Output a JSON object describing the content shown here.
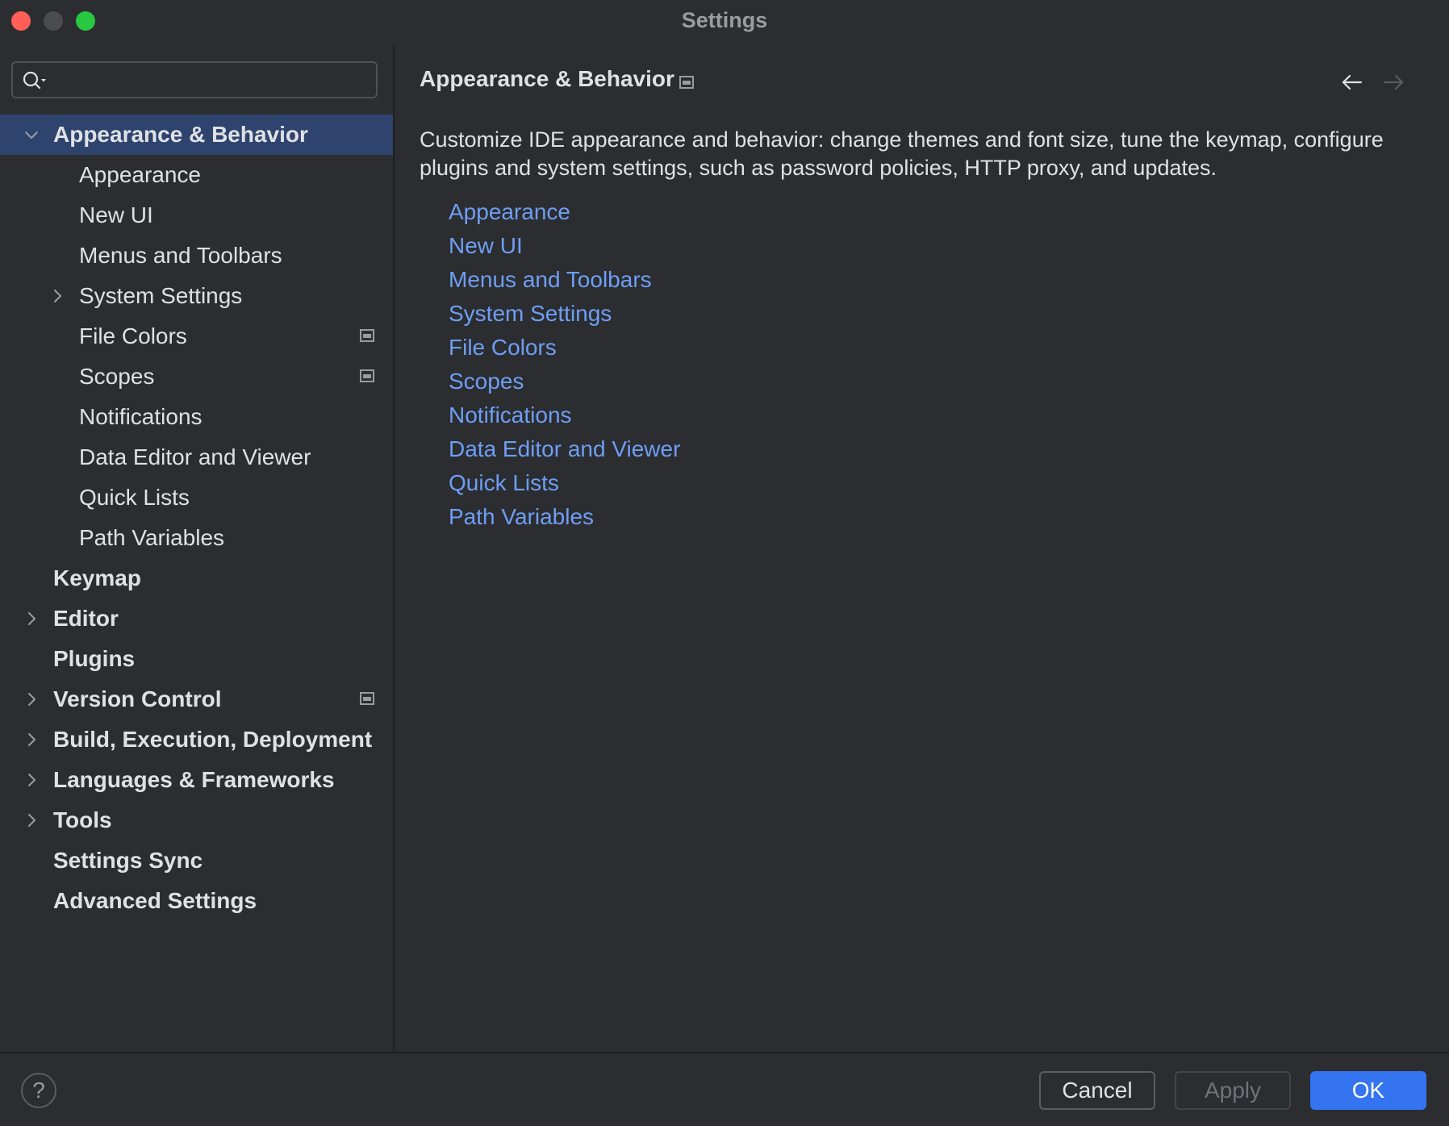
{
  "window": {
    "title": "Settings"
  },
  "search": {
    "value": ""
  },
  "tree": [
    {
      "label": "Appearance & Behavior",
      "level": 0,
      "expanded": true,
      "chevron": "down",
      "selected": true,
      "top": true
    },
    {
      "label": "Appearance",
      "level": 1
    },
    {
      "label": "New UI",
      "level": 1
    },
    {
      "label": "Menus and Toolbars",
      "level": 1
    },
    {
      "label": "System Settings",
      "level": 1,
      "chevron": "right"
    },
    {
      "label": "File Colors",
      "level": 1,
      "project_icon": true
    },
    {
      "label": "Scopes",
      "level": 1,
      "project_icon": true
    },
    {
      "label": "Notifications",
      "level": 1
    },
    {
      "label": "Data Editor and Viewer",
      "level": 1
    },
    {
      "label": "Quick Lists",
      "level": 1
    },
    {
      "label": "Path Variables",
      "level": 1
    },
    {
      "label": "Keymap",
      "level": 0,
      "top": true
    },
    {
      "label": "Editor",
      "level": 0,
      "chevron": "right",
      "top": true
    },
    {
      "label": "Plugins",
      "level": 0,
      "top": true
    },
    {
      "label": "Version Control",
      "level": 0,
      "chevron": "right",
      "top": true,
      "project_icon": true
    },
    {
      "label": "Build, Execution, Deployment",
      "level": 0,
      "chevron": "right",
      "top": true
    },
    {
      "label": "Languages & Frameworks",
      "level": 0,
      "chevron": "right",
      "top": true
    },
    {
      "label": "Tools",
      "level": 0,
      "chevron": "right",
      "top": true
    },
    {
      "label": "Settings Sync",
      "level": 0,
      "top": true
    },
    {
      "label": "Advanced Settings",
      "level": 0,
      "top": true
    }
  ],
  "main": {
    "title": "Appearance & Behavior",
    "description": "Customize IDE appearance and behavior: change themes and font size, tune the keymap, configure plugins and system settings, such as password policies, HTTP proxy, and updates.",
    "links": [
      "Appearance",
      "New UI",
      "Menus and Toolbars",
      "System Settings",
      "File Colors",
      "Scopes",
      "Notifications",
      "Data Editor and Viewer",
      "Quick Lists",
      "Path Variables"
    ]
  },
  "footer": {
    "help_label": "?",
    "cancel_label": "Cancel",
    "apply_label": "Apply",
    "ok_label": "OK"
  },
  "colors": {
    "background": "#2b2d30",
    "selection": "#2e436e",
    "link": "#6f9ef5",
    "accent": "#3574f0"
  },
  "icons": [
    "search-icon",
    "chevron-down-icon",
    "chevron-right-icon",
    "project-scope-icon",
    "back-arrow-icon",
    "forward-arrow-icon",
    "help-icon"
  ]
}
